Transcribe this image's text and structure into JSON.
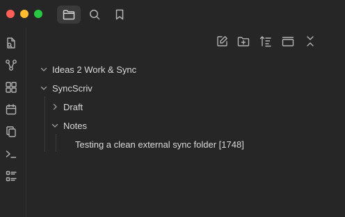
{
  "titlebar": {
    "tabs": [
      {
        "icon": "folder-icon",
        "active": true
      },
      {
        "icon": "search-icon",
        "active": false
      },
      {
        "icon": "bookmark-icon",
        "active": false
      }
    ]
  },
  "ribbon": {
    "icons": [
      "file-search-icon",
      "graph-icon",
      "canvas-icon",
      "calendar-icon",
      "copy-icon",
      "terminal-icon",
      "list-icon"
    ]
  },
  "file_nav": {
    "actions": [
      "new-note-icon",
      "new-folder-icon",
      "sort-icon",
      "collapse-pane-icon",
      "collapse-all-icon"
    ]
  },
  "tree": {
    "root1": "Ideas 2 Work & Sync",
    "root2": "SyncScriv",
    "draft": "Draft",
    "notes": "Notes",
    "file": "Testing a clean external sync folder [1748]"
  },
  "colors": {
    "background": "#1e1e1e",
    "panel": "#262626",
    "text": "#dadada",
    "icon": "#b3b3b3"
  }
}
